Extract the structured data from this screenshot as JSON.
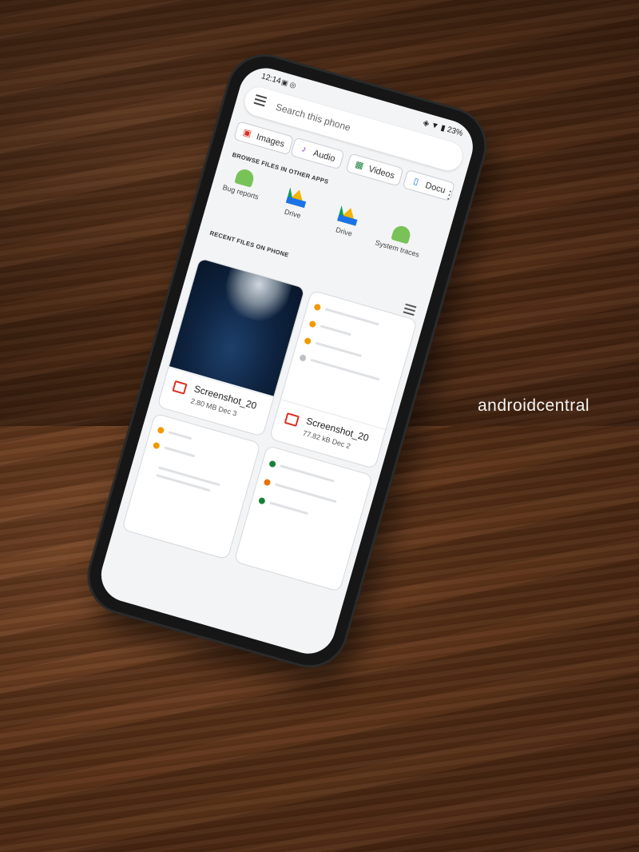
{
  "status": {
    "time": "12:14",
    "battery": "23%"
  },
  "search": {
    "placeholder": "Search this phone"
  },
  "chips": [
    {
      "label": "Images",
      "icon": "image-icon",
      "color": "#d93025"
    },
    {
      "label": "Audio",
      "icon": "music-note-icon",
      "color": "#7b2cbf"
    },
    {
      "label": "Videos",
      "icon": "film-icon",
      "color": "#188038"
    },
    {
      "label": "Docu",
      "icon": "document-icon",
      "color": "#1a73e8"
    }
  ],
  "sections": {
    "browse": "BROWSE FILES IN OTHER APPS",
    "recent": "RECENT FILES ON PHONE"
  },
  "apps": [
    {
      "label": "Bug reports",
      "icon": "android-icon"
    },
    {
      "label": "Drive",
      "icon": "drive-icon"
    },
    {
      "label": "Drive",
      "icon": "drive-icon"
    },
    {
      "label": "System traces",
      "icon": "android-icon"
    }
  ],
  "files": [
    {
      "name": "Screenshot_20",
      "meta": "2.80 MB Dec 3"
    },
    {
      "name": "Screenshot_20",
      "meta": "77.82 kB Dec 2"
    }
  ],
  "watermark": "androidcentral"
}
